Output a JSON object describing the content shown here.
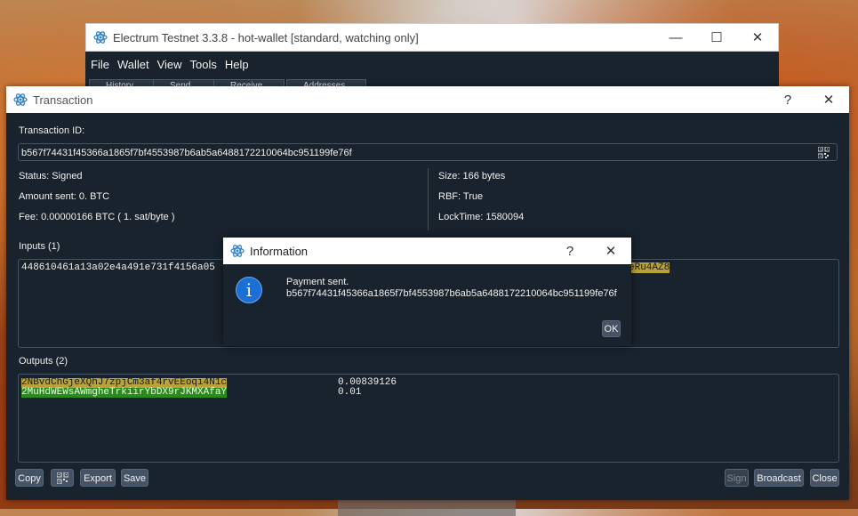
{
  "main_window": {
    "title": "Electrum Testnet 3.3.8  -  hot-wallet  [standard, watching only]",
    "menu": [
      "File",
      "Wallet",
      "View",
      "Tools",
      "Help"
    ],
    "tabs_partial": [
      "History",
      "Send",
      "Receive",
      "Addresses"
    ],
    "controls": {
      "minimize": "—",
      "maximize": "☐",
      "close": "✕"
    }
  },
  "tx_dialog": {
    "title": "Transaction",
    "help": "?",
    "close": "✕",
    "txid_label": "Transaction ID:",
    "txid": "b567f74431f45366a1865f7bf4553987b6ab5a648817221006 4bc951199fe76f",
    "status": "Status: Signed",
    "amount_sent": "Amount sent: 0. BTC",
    "fee": "Fee: 0.00000166 BTC  ( 1. sat/byte )",
    "size": "Size: 166 bytes",
    "rbf": "RBF: True",
    "locktime": "LockTime: 1580094",
    "inputs_label": "Inputs (1)",
    "input_prefix": "448610461a13a02e4a491e731f4156a05",
    "input_addr_tail": "eRu4AZ8",
    "outputs_label": "Outputs (2)",
    "outputs": [
      {
        "address": "2NBvdChGjeXQhJ7zpjCm3af4rvEEoqi4N1c",
        "amount": "0.00839126"
      },
      {
        "address": "2MuHdWEWsAWmgheTrkiirYbDX9rJKMXAfaY",
        "amount": "0.01"
      }
    ],
    "buttons": {
      "copy": "Copy",
      "export": "Export",
      "save": "Save",
      "sign": "Sign",
      "broadcast": "Broadcast",
      "close": "Close"
    }
  },
  "info_dialog": {
    "title": "Information",
    "help": "?",
    "close": "✕",
    "icon": "i",
    "message_line1": "Payment sent.",
    "message_line2": "b567f74431f45366a1865f7bf4553987b6ab5a648817221006 4bc951199fe76f",
    "ok": "OK"
  },
  "colors": {
    "dark_bg": "#19232d",
    "border": "#455364",
    "output_highlight_1": "#b9a23a",
    "output_highlight_2": "#2b8a1d",
    "info_blue": "#1c6fd6"
  }
}
